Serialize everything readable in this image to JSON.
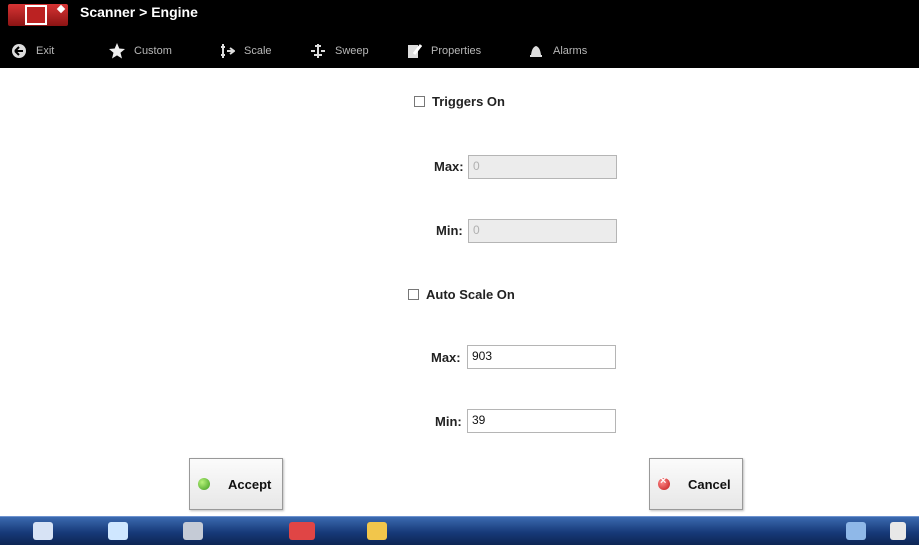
{
  "header": {
    "title": "Scanner > Engine"
  },
  "toolbar": {
    "items": [
      {
        "label": "Exit",
        "icon": "exit-arrow-icon"
      },
      {
        "label": "Custom",
        "icon": "star-icon"
      },
      {
        "label": "Scale",
        "icon": "scale-icon"
      },
      {
        "label": "Sweep",
        "icon": "sweep-icon"
      },
      {
        "label": "Properties",
        "icon": "properties-icon"
      },
      {
        "label": "Alarms",
        "icon": "alarm-bell-icon"
      }
    ]
  },
  "form": {
    "triggers": {
      "checkbox_label": "Triggers On",
      "checked": false,
      "max_label": "Max:",
      "max_value": "0",
      "min_label": "Min:",
      "min_value": "0",
      "disabled": true
    },
    "autoscale": {
      "checkbox_label": "Auto Scale On",
      "checked": false,
      "max_label": "Max:",
      "max_value": "903",
      "min_label": "Min:",
      "min_value": "39"
    }
  },
  "buttons": {
    "accept_label": "Accept",
    "cancel_label": "Cancel"
  },
  "taskbar": {
    "icons": [
      "home-icon",
      "browser-icon",
      "tools-icon",
      "vehicle-icon",
      "folder-icon",
      "wifi-icon",
      "signal-icon"
    ]
  },
  "colors": {
    "accept_icon": "#3c9a1e",
    "cancel_icon": "#c01616",
    "header_bg": "#000000",
    "taskbar_bg": "#173a79"
  }
}
